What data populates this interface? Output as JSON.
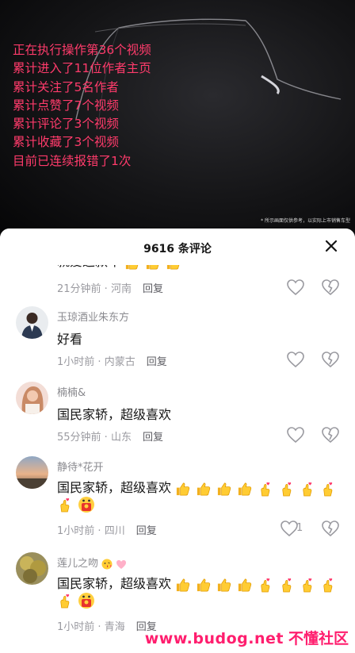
{
  "overlay_log": [
    "正在执行操作第36个视频",
    "累计进入了11位作者主页",
    "累计关注了5名作者",
    "累计点赞了7个视频",
    "累计评论了3个视频",
    "累计收藏了3个视频",
    "目前已连续报错了1次"
  ],
  "video_disclaimer": "* 所示画面仅供参考，以实际上市销售车型",
  "comments_header": {
    "title": "9616 条评论"
  },
  "comments": [
    {
      "username": "",
      "text": "就爱这款车",
      "time": "21分钟前",
      "location": "河南",
      "reply_label": "回复",
      "like_count": ""
    },
    {
      "username": "玉琼酒业朱东方",
      "text": "好看",
      "time": "1小时前",
      "location": "内蒙古",
      "reply_label": "回复",
      "like_count": ""
    },
    {
      "username": "楠楠&",
      "text": "国民家轿，超级喜欢",
      "time": "55分钟前",
      "location": "山东",
      "reply_label": "回复",
      "like_count": ""
    },
    {
      "username": "静待*花开",
      "text": "国民家轿，超级喜欢",
      "time": "1小时前",
      "location": "四川",
      "reply_label": "回复",
      "like_count": "1"
    },
    {
      "username": "莲儿之吻",
      "text": "国民家轿，超级喜欢",
      "time": "1小时前",
      "location": "青海",
      "reply_label": "回复",
      "like_count": ""
    }
  ],
  "watermark": {
    "url": "www.budog.net",
    "brand": "不懂社区"
  },
  "colors": {
    "overlay_text": "#ff3b6b",
    "watermark": "#ff1e6e"
  }
}
